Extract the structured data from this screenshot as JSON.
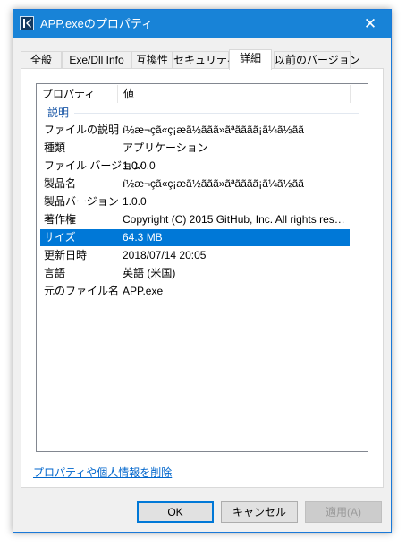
{
  "window": {
    "title": "APP.exeのプロパティ",
    "close_glyph": "✕"
  },
  "tabs": [
    {
      "label": "全般",
      "active": false
    },
    {
      "label": "Exe/Dll Info",
      "active": false
    },
    {
      "label": "互換性",
      "active": false
    },
    {
      "label": "セキュリティ",
      "active": false
    },
    {
      "label": "詳細",
      "active": true
    },
    {
      "label": "以前のバージョン",
      "active": false
    }
  ],
  "details": {
    "columns": [
      "プロパティ",
      "値"
    ],
    "group": "説明",
    "rows": [
      {
        "name": "ファイルの説明",
        "value": "ï½æ¬çã«ç¡æã½ããã»ãªãããã¡ã¼ã½ãã"
      },
      {
        "name": "種類",
        "value": "アプリケーション"
      },
      {
        "name": "ファイル バージョン",
        "value": "1.0.0.0"
      },
      {
        "name": "製品名",
        "value": "ï½æ¬çã«ç¡æã½ããã»ãªãããã¡ã¼ã½ãã"
      },
      {
        "name": "製品バージョン",
        "value": "1.0.0"
      },
      {
        "name": "著作権",
        "value": "Copyright (C) 2015 GitHub, Inc. All rights rese..."
      },
      {
        "name": "サイズ",
        "value": "64.3 MB",
        "selected": true
      },
      {
        "name": "更新日時",
        "value": "2018/07/14 20:05"
      },
      {
        "name": "言語",
        "value": "英語 (米国)"
      },
      {
        "name": "元のファイル名",
        "value": "APP.exe"
      }
    ]
  },
  "links": {
    "remove_properties": "プロパティや個人情報を削除"
  },
  "buttons": {
    "ok": "OK",
    "cancel": "キャンセル",
    "apply": "適用(A)"
  },
  "colors": {
    "titlebar": "#1883d7",
    "selection": "#0078d7",
    "link": "#0066cc",
    "group_header": "#1e5aa8"
  }
}
